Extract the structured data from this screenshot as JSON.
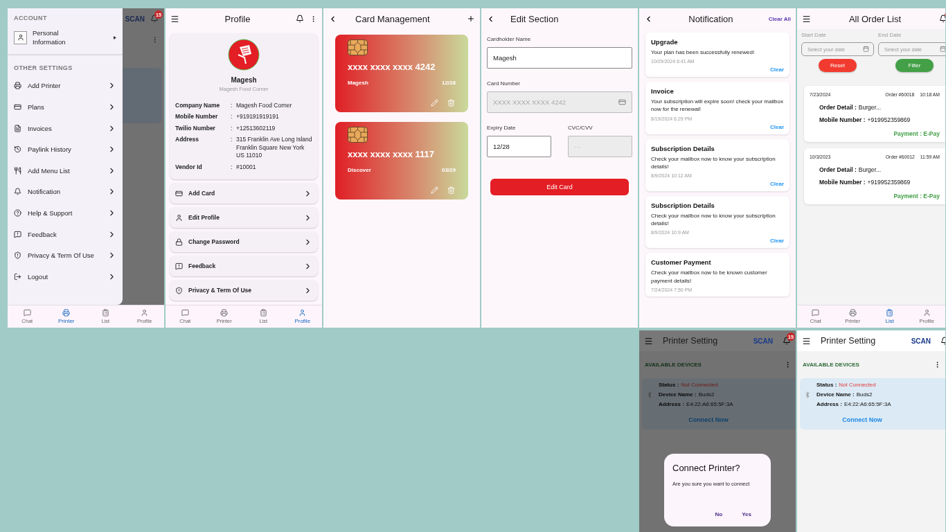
{
  "drawer_screen": {
    "account_heading": "ACCOUNT",
    "account_item": "Personal Information",
    "settings_heading": "OTHER SETTINGS",
    "items": [
      "Add Printer",
      "Plans",
      "Invoices",
      "Paylink History",
      "Add Menu List",
      "Notification",
      "Help & Support",
      "Feedback",
      "Privacy & Term Of Use",
      "Logout"
    ],
    "behind": {
      "action": "SCAN",
      "badge": "15"
    },
    "bottom_nav": [
      {
        "label": "Chat",
        "selected": false
      },
      {
        "label": "Printer",
        "selected": true
      },
      {
        "label": "List",
        "selected": false
      },
      {
        "label": "Profile",
        "selected": false
      }
    ]
  },
  "profile_screen": {
    "title": "Profile",
    "name": "Magesh",
    "company": "Magesh Food Corner",
    "details": [
      {
        "label": "Company Name",
        "separator": ":",
        "value": "Magesh Food Corner"
      },
      {
        "label": "Mobile Number",
        "separator": ":",
        "value": "+919191919191"
      },
      {
        "label": "Twilio Number",
        "separator": ":",
        "value": "+12513602119"
      },
      {
        "label": "Address",
        "separator": ":",
        "value": "315 Franklin Ave Long Island Franklin Square New York US 11010"
      },
      {
        "label": "Vendor Id",
        "separator": ":",
        "value": "#10001"
      }
    ],
    "menu": [
      "Add Card",
      "Edit Profile",
      "Change Password",
      "Feedback",
      "Privacy & Term Of Use"
    ],
    "bottom_nav": [
      {
        "label": "Chat",
        "selected": false
      },
      {
        "label": "Printer",
        "selected": false
      },
      {
        "label": "List",
        "selected": false
      },
      {
        "label": "Profile",
        "selected": true
      }
    ]
  },
  "card_management": {
    "title": "Card Management",
    "cards": [
      {
        "number": "xxxx xxxx xxxx 4242",
        "holder": "Magesh",
        "expiry": "12/28"
      },
      {
        "number": "xxxx xxxx xxxx 1117",
        "holder": "Discover",
        "expiry": "03/29"
      }
    ]
  },
  "edit_section": {
    "title": "Edit Section",
    "fields": [
      {
        "label": "Cardholder Name",
        "value": "Magesh",
        "disabled": false,
        "kind": "text"
      },
      {
        "label": "Card Number",
        "placeholder": "XXXX XXXX XXXX 4242",
        "disabled": true,
        "kind": "card"
      },
      {
        "label": "Expiry Date",
        "value": "12/28",
        "disabled": false,
        "kind": "text"
      },
      {
        "label": "CVC/CVV",
        "placeholder": "···",
        "disabled": true,
        "kind": "text"
      }
    ],
    "button": "Edit Card"
  },
  "notifications": {
    "title": "Notification",
    "clear_all": "Clear All",
    "items": [
      {
        "title": "Upgrade",
        "message": "Your plan has been successfully renewed!",
        "time": "10/29/2024 6:41 AM",
        "clear": "Clear"
      },
      {
        "title": "Invoice",
        "message": "Your subscription will expire soon! check your mailbox now for the renewal!",
        "time": "8/19/2024 6:29 PM",
        "clear": "Clear"
      },
      {
        "title": "Subscription Details",
        "message": "Check your mailbox now to know your subscription details!",
        "time": "8/9/2024 10:12 AM",
        "clear": "Clear"
      },
      {
        "title": "Subscription Details",
        "message": "Check your mailbox now to know your subscription details!",
        "time": "8/9/2024 10:9 AM",
        "clear": "Clear"
      },
      {
        "title": "Customer Payment",
        "message": "Check your mailbox now to be known customer payment details!",
        "time": "7/24/2024 7:50 PM"
      }
    ]
  },
  "order_list": {
    "title": "All Order List",
    "filters": [
      {
        "label": "Start Date",
        "placeholder": "Select your date"
      },
      {
        "label": "End Date",
        "placeholder": "Select your date"
      }
    ],
    "reset": "Reset",
    "filter": "Filter",
    "orders": [
      {
        "date": "7/23/2024",
        "order": "Order #60018",
        "time": "10:18 AM",
        "detail_label": "Order Detail :",
        "detail": "Burger...",
        "mobile_label": "Mobile Number :",
        "mobile": "+919952359869",
        "payment": "Payment : E-Pay"
      },
      {
        "date": "10/3/2023",
        "order": "Order #60012",
        "time": "11:59 AM",
        "detail_label": "Order Detail :",
        "detail": "Burger...",
        "mobile_label": "Mobile Number :",
        "mobile": "+919952359869",
        "payment": "Payment : E-Pay"
      }
    ],
    "bottom_nav": [
      {
        "label": "Chat",
        "selected": false
      },
      {
        "label": "Printer",
        "selected": false
      },
      {
        "label": "List",
        "selected": true
      },
      {
        "label": "Profile",
        "selected": false
      }
    ]
  },
  "printer_dialog_screen": {
    "title": "Printer Setting",
    "action": "SCAN",
    "badge": "15",
    "section": "AVAILABLE DEVICES",
    "device": {
      "status_label": "Status :",
      "status": "Not Connected",
      "name_label": "Device Name :",
      "name": "Buds2",
      "address_label": "Address :",
      "address": "E4:22:A6:65:5F:3A",
      "connect": "Connect Now"
    },
    "dialog": {
      "title": "Connect Printer?",
      "message": "Are you sure you want to connect",
      "buttons": [
        "No",
        "Yes"
      ]
    }
  },
  "printer_screen": {
    "title": "Printer Setting",
    "action": "SCAN",
    "section": "AVAILABLE DEVICES",
    "device": {
      "status_label": "Status :",
      "status": "Not Connected",
      "name_label": "Device Name :",
      "name": "Buds2",
      "address_label": "Address :",
      "address": "E4:22:A6:65:5F:3A",
      "connect": "Connect Now"
    }
  }
}
